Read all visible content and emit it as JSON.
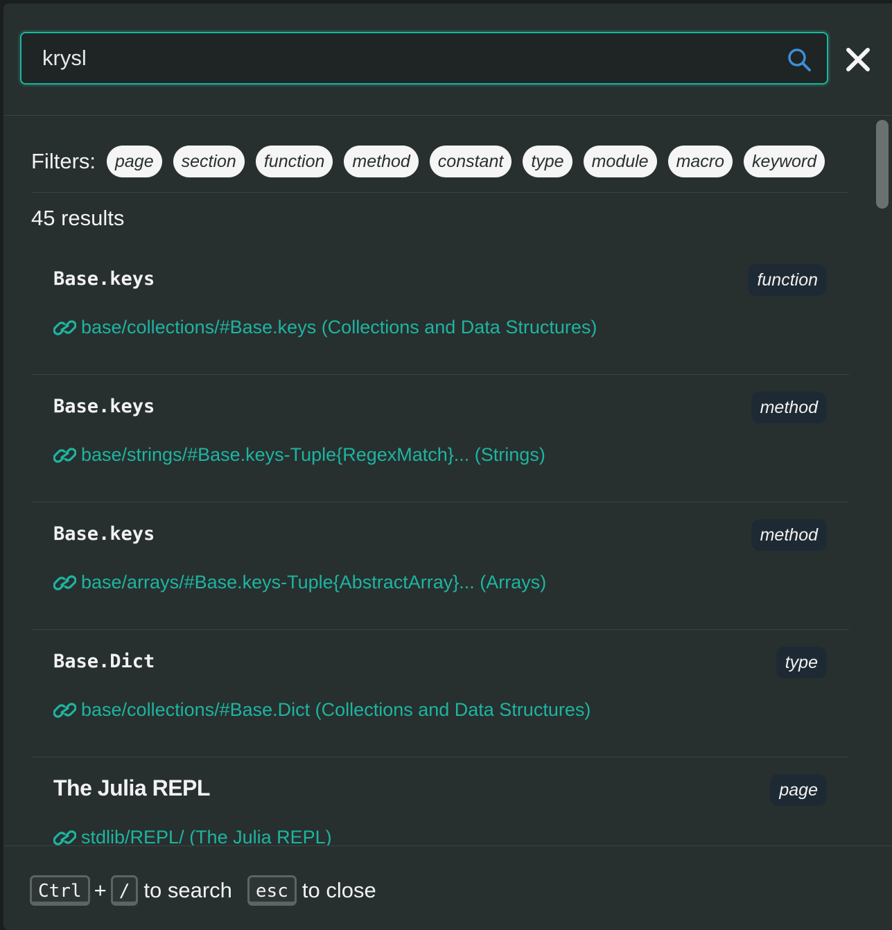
{
  "search": {
    "value": "krysl",
    "placeholder": ""
  },
  "filters": {
    "label": "Filters:",
    "items": [
      "page",
      "section",
      "function",
      "method",
      "constant",
      "type",
      "module",
      "macro",
      "keyword"
    ]
  },
  "result_count": "45 results",
  "results": [
    {
      "title": "Base.keys",
      "badge": "function",
      "link": "base/collections/#Base.keys (Collections and Data Structures)"
    },
    {
      "title": "Base.keys",
      "badge": "method",
      "link": "base/strings/#Base.keys-Tuple{RegexMatch}... (Strings)"
    },
    {
      "title": "Base.keys",
      "badge": "method",
      "link": "base/arrays/#Base.keys-Tuple{AbstractArray}... (Arrays)"
    },
    {
      "title": "Base.Dict",
      "badge": "type",
      "link": "base/collections/#Base.Dict (Collections and Data Structures)"
    },
    {
      "title": "The Julia REPL",
      "badge": "page",
      "link": "stdlib/REPL/ (The Julia REPL)"
    }
  ],
  "footer": {
    "key_ctrl": "Ctrl",
    "plus": "+",
    "key_slash": "/",
    "search_hint": "to search",
    "key_esc": "esc",
    "close_hint": "to close"
  },
  "colors": {
    "accent": "#1db5a0",
    "background": "#282f2f",
    "badge_bg": "#1e2a33"
  },
  "icons": {
    "search": "search-icon",
    "close": "close-icon",
    "link": "link-icon"
  }
}
